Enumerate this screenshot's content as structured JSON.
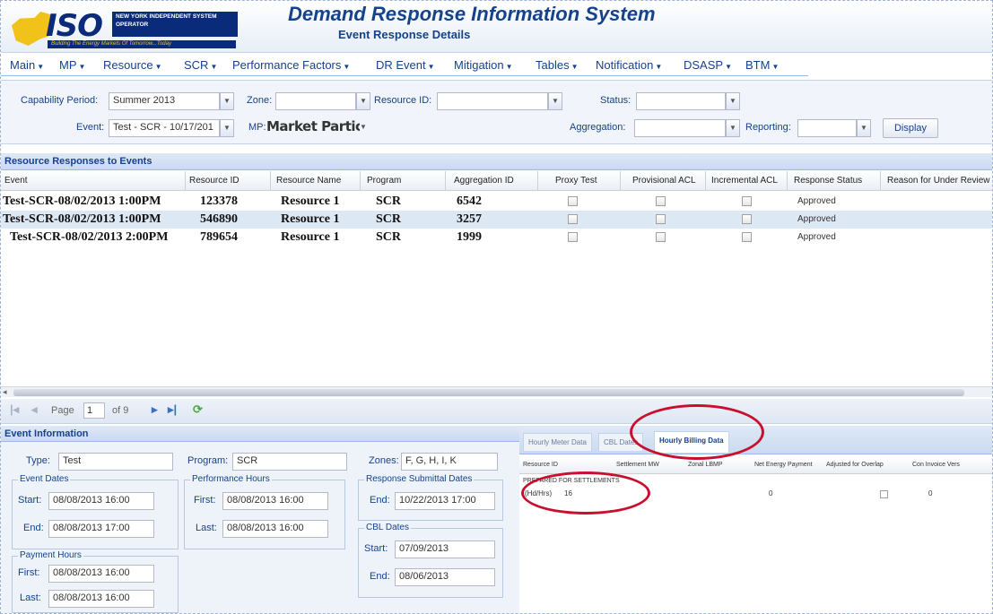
{
  "header": {
    "logo_mark": "ISO",
    "logo_org": "NEW YORK INDEPENDENT SYSTEM OPERATOR",
    "logo_tagline": "Building The Energy Markets Of Tomorrow...Today",
    "app_title": "Demand Response Information System",
    "page_title": "Event Response Details"
  },
  "menu": [
    {
      "label": "Main"
    },
    {
      "label": "MP"
    },
    {
      "label": "Resource"
    },
    {
      "label": "SCR"
    },
    {
      "label": "Performance Factors"
    },
    {
      "label": "DR Event"
    },
    {
      "label": "Mitigation"
    },
    {
      "label": "Tables"
    },
    {
      "label": "Notification"
    },
    {
      "label": "DSASP"
    },
    {
      "label": "BTM"
    }
  ],
  "filters": {
    "capability_period_label": "Capability Period:",
    "capability_period_value": "Summer 2013",
    "zone_label": "Zone:",
    "zone_value": "",
    "resource_id_label": "Resource ID:",
    "resource_id_value": "",
    "status_label": "Status:",
    "status_value": "",
    "event_label": "Event:",
    "event_value": "Test - SCR - 10/17/201",
    "mp_label": "MP:",
    "mp_value": "Market Participant",
    "aggregation_label": "Aggregation:",
    "aggregation_value": "",
    "reporting_label": "Reporting:",
    "reporting_value": "",
    "display_button": "Display"
  },
  "grid": {
    "title": "Resource Responses to Events",
    "columns": [
      "Event",
      "Resource ID",
      "Resource Name",
      "Program",
      "Aggregation ID",
      "Proxy Test",
      "Provisional ACL",
      "Incremental ACL",
      "Response Status",
      "Reason for Under Review"
    ],
    "rows": [
      {
        "event": "Test-SCR-08/02/2013 1:00PM",
        "resource_id": "123378",
        "resource_name": "Resource 1",
        "program": "SCR",
        "aggregation_id": "6542",
        "proxy_test": false,
        "provisional_acl": false,
        "incremental_acl": false,
        "status": "Approved"
      },
      {
        "event": "Test-SCR-08/02/2013 1:00PM",
        "resource_id": "546890",
        "resource_name": "Resource 1",
        "program": "SCR",
        "aggregation_id": "3257",
        "proxy_test": false,
        "provisional_acl": false,
        "incremental_acl": false,
        "status": "Approved"
      },
      {
        "event": "Test-SCR-08/02/2013 2:00PM",
        "resource_id": "789654",
        "resource_name": "Resource 1",
        "program": "SCR",
        "aggregation_id": "1999",
        "proxy_test": false,
        "provisional_acl": false,
        "incremental_acl": false,
        "status": "Approved"
      }
    ]
  },
  "paging": {
    "page_label": "Page",
    "page_value": "1",
    "of_label": "of 9"
  },
  "event_info": {
    "title": "Event Information",
    "type_label": "Type:",
    "type_value": "Test",
    "program_label": "Program:",
    "program_value": "SCR",
    "zones_label": "Zones:",
    "zones_value": "F, G, H, I, K",
    "event_dates_legend": "Event Dates",
    "start_label": "Start:",
    "event_start": "08/08/2013 16:00",
    "end_label": "End:",
    "event_end": "08/08/2013 17:00",
    "perf_hours_legend": "Performance Hours",
    "first_label": "First:",
    "perf_first": "08/08/2013 16:00",
    "last_label": "Last:",
    "perf_last": "08/08/2013 16:00",
    "response_legend": "Response Submittal Dates",
    "response_end": "10/22/2013 17:00",
    "payment_legend": "Payment Hours",
    "pay_first": "08/08/2013 16:00",
    "pay_last": "08/08/2013 16:00",
    "cbl_legend": "CBL Dates",
    "cbl_start": "07/09/2013",
    "cbl_end": "08/06/2013"
  },
  "billing": {
    "tabs": [
      {
        "label": "Hourly Meter Data"
      },
      {
        "label": "CBL Dates"
      },
      {
        "label": "Hourly Billing Data"
      }
    ],
    "columns": [
      "Resource ID",
      "Settlement MW",
      "Zonal LBMP",
      "Net Energy Payment",
      "Adjusted for Overlap",
      "Con Invoice Vers"
    ],
    "group_label": "PREPARED FOR SETTLEMENTS",
    "row": {
      "label": "(Hd/Hrs)",
      "value": "16",
      "lbmp": "0",
      "net": "0",
      "overlap": false,
      "version": "0"
    }
  },
  "colors": {
    "accent": "#15428b",
    "annotation": "#c8102e",
    "logo_gold": "#f0c21a",
    "logo_navy": "#0a2a7a"
  }
}
